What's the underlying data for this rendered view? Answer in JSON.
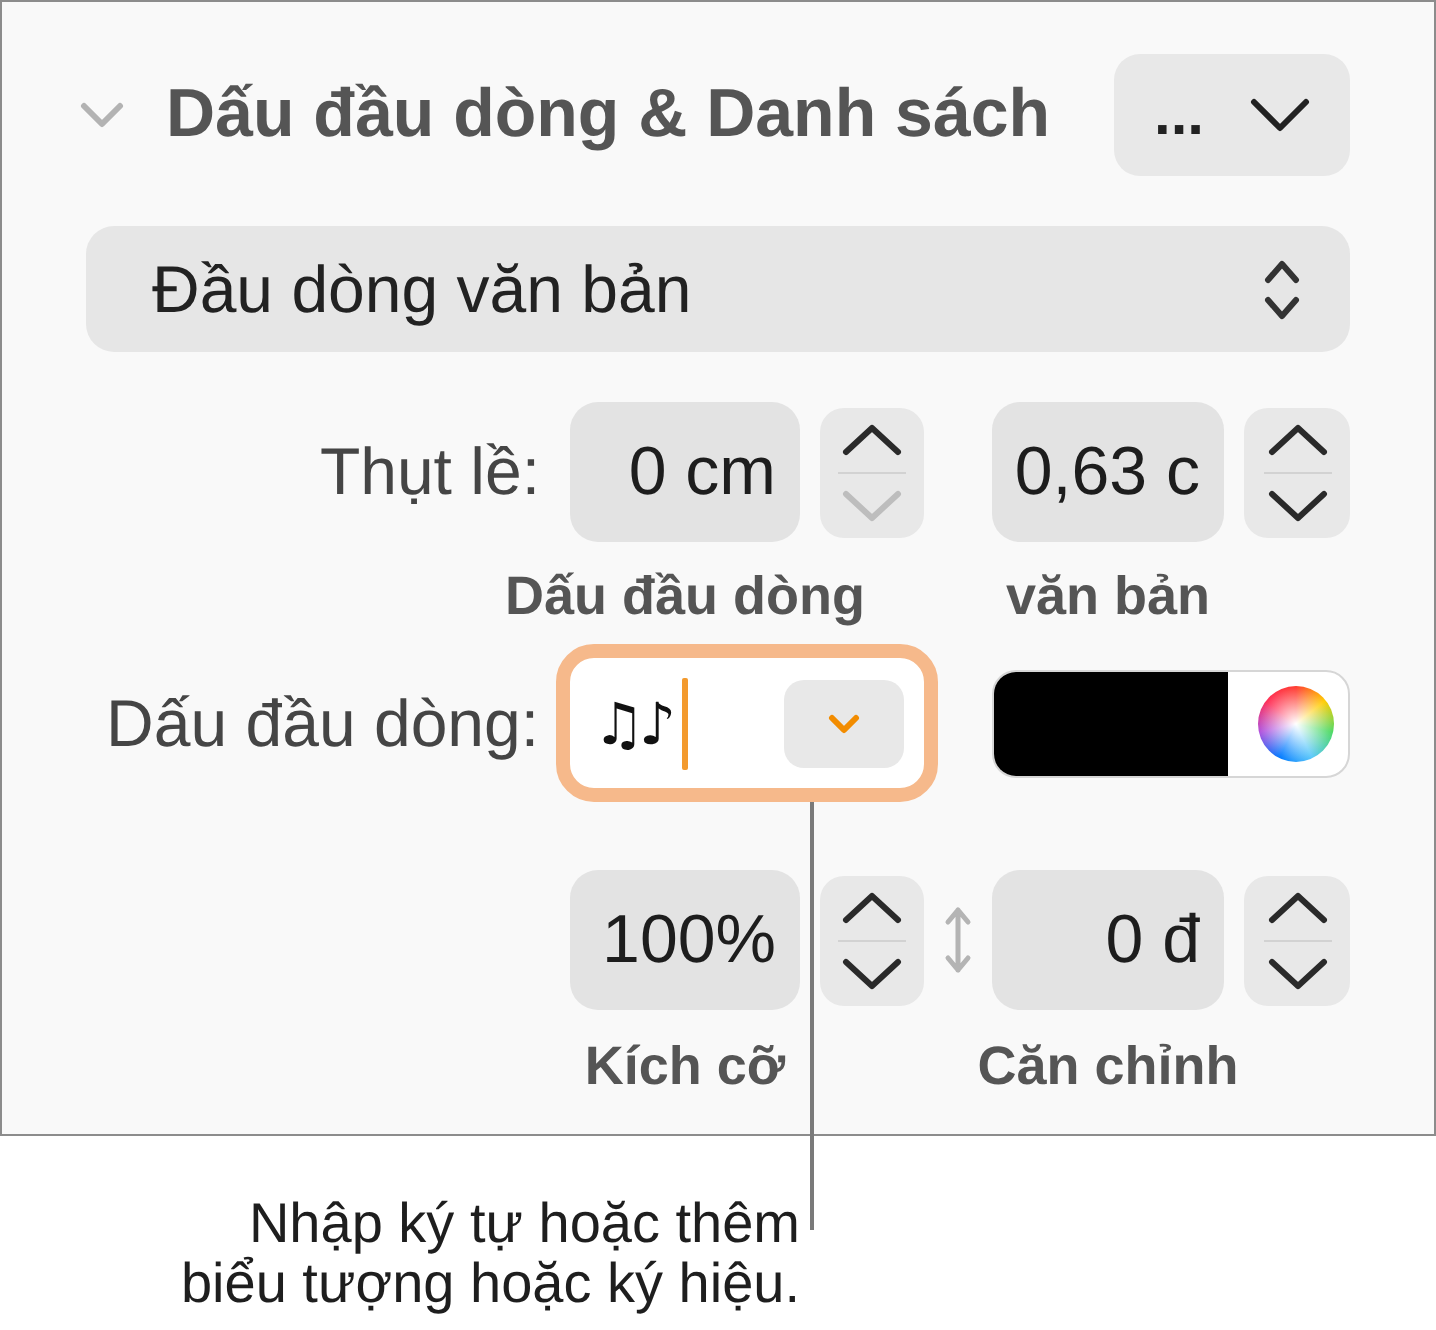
{
  "section": {
    "title": "Dấu đầu dòng & Danh sách",
    "expanded": true,
    "menu_button": {
      "label": "..."
    }
  },
  "bullet_style": {
    "value": "Đầu dòng văn bản"
  },
  "indent": {
    "label": "Thụt lề:",
    "fields": [
      {
        "value": "0 cm",
        "caption": "Dấu đầu dòng",
        "up_disabled": false,
        "down_disabled": true
      },
      {
        "value": "0,63 c",
        "caption": "văn bản",
        "up_disabled": false,
        "down_disabled": false
      }
    ]
  },
  "bullet": {
    "label": "Dấu đầu dòng:",
    "value": "♫♪",
    "focused": true,
    "color": "#000000"
  },
  "size_alignment": {
    "fields": [
      {
        "value": "100%",
        "caption": "Kích cỡ",
        "up_disabled": false,
        "down_disabled": false
      },
      {
        "value": "0 đ",
        "caption": "Căn chỉnh",
        "up_disabled": false,
        "down_disabled": false
      }
    ]
  },
  "callout": {
    "text": "Nhập ký tự hoặc thêm\nbiểu tượng hoặc ký hiệu."
  }
}
